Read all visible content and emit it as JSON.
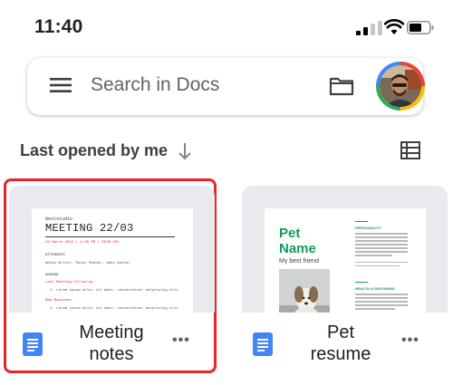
{
  "status": {
    "time": "11:40"
  },
  "search": {
    "placeholder": "Search in Docs"
  },
  "section": {
    "label": "Last opened by me"
  },
  "docs": [
    {
      "title_line1": "Meeting",
      "title_line2": "notes",
      "preview": {
        "kicker": "Nextstudio",
        "heading": "MEETING 22/03",
        "date_line": "22 March 2022 | 4:30 PM | ROOM 301",
        "attendees_label": "ATTENDEES",
        "attendees": "Wendy Writer, Ronny Reader, Abby Author",
        "agenda_label": "AGENDA",
        "items": [
          "Last Meeting Follow-up",
          "New Business"
        ],
        "item_body": "1. Lorem ipsum dolor sit amet, consectetuer adipiscing elit"
      }
    },
    {
      "title_line1": "Pet",
      "title_line2": "resume",
      "preview": {
        "name_line1": "Pet",
        "name_line2": "Name",
        "subtitle": "My best friend",
        "section1": "PERSONALITY",
        "section2": "HEALTH & GROOMING"
      }
    }
  ],
  "colors": {
    "accent_red": "#e8232a",
    "docs_blue": "#4285f4",
    "pet_green": "#0f9d58"
  }
}
